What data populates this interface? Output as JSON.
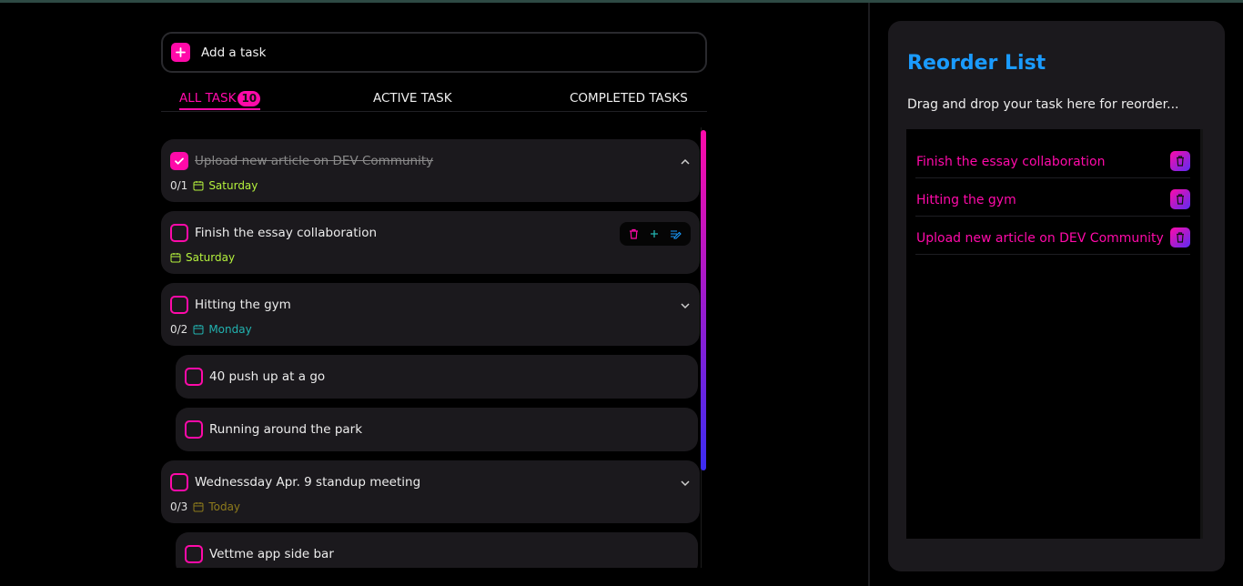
{
  "add_task": {
    "label": "Add a task"
  },
  "tabs": [
    {
      "label": "ALL TASK",
      "badge": "10",
      "active": true
    },
    {
      "label": "ACTIVE TASK"
    },
    {
      "label": "COMPLETED TASKS"
    }
  ],
  "tasks": [
    {
      "title": "Upload new article on DEV Community",
      "done": true,
      "progress": "0/1",
      "day": "Saturday",
      "day_color": "#b5f23d"
    },
    {
      "title": "Finish the essay collaboration",
      "done": false,
      "day": "Saturday",
      "day_color": "#b5f23d"
    },
    {
      "title": "Hitting the gym",
      "done": false,
      "progress": "0/2",
      "day": "Monday",
      "day_color": "#22b3b0",
      "subtasks": [
        {
          "title": "40 push up at a go"
        },
        {
          "title": "Running around the park"
        }
      ]
    },
    {
      "title": "Wednessday Apr. 9 standup meeting",
      "done": false,
      "progress": "0/3",
      "day": "Today",
      "day_color": "#8e7b1c",
      "subtasks": [
        {
          "title": "Vettme app side bar"
        }
      ]
    }
  ],
  "colors": {
    "accent": "#ff0aa9",
    "heading": "#1a9bff",
    "card": "#1b191d",
    "background": "#000000"
  },
  "reorder": {
    "title": "Reorder List",
    "description": "Drag and drop your task here for reorder...",
    "items": [
      {
        "label": "Finish the essay collaboration"
      },
      {
        "label": "Hitting the gym"
      },
      {
        "label": "Upload new article on DEV Community"
      }
    ]
  }
}
